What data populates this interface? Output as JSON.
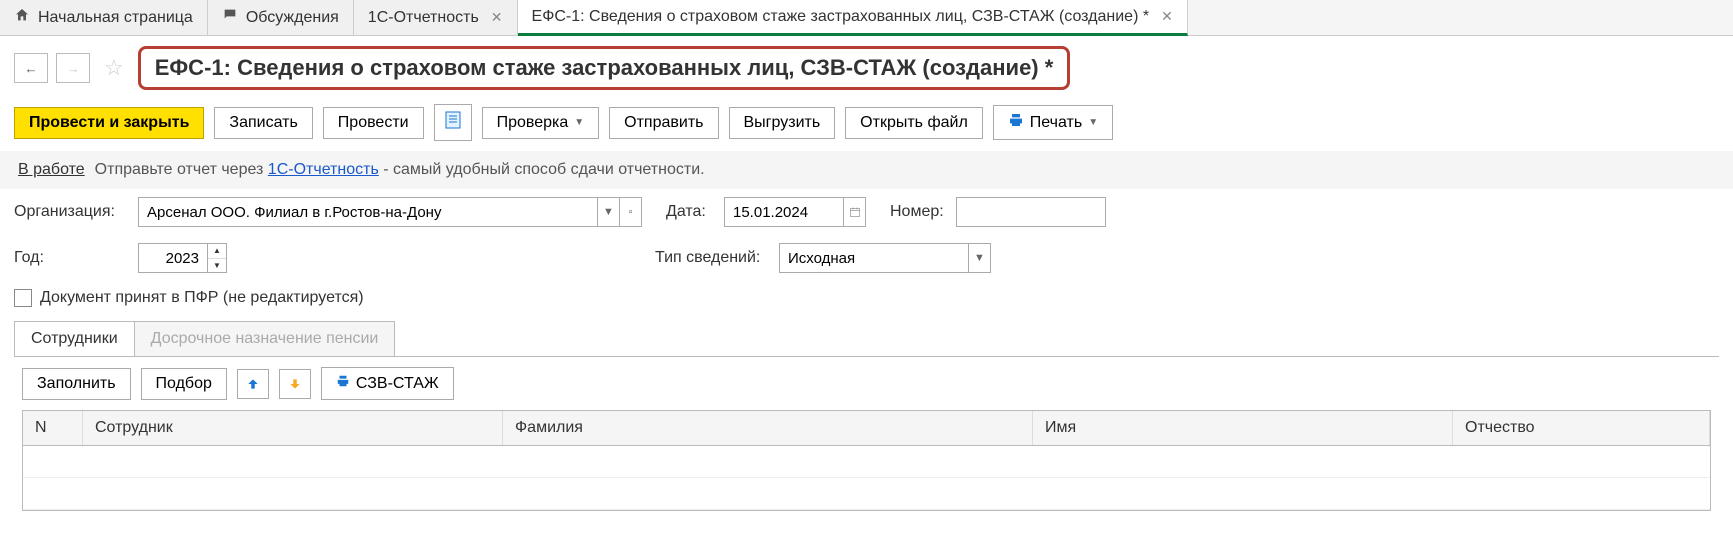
{
  "tabs": [
    {
      "icon": "home",
      "label": "Начальная страница"
    },
    {
      "icon": "discuss",
      "label": "Обсуждения"
    },
    {
      "label": "1С-Отчетность",
      "closable": true
    },
    {
      "label": "ЕФС-1: Сведения о страховом стаже застрахованных лиц, СЗВ-СТАЖ (создание) *",
      "closable": true,
      "active": true
    }
  ],
  "page_title": "ЕФС-1: Сведения о страховом стаже застрахованных лиц, СЗВ-СТАЖ (создание) *",
  "toolbar": {
    "post_close": "Провести и закрыть",
    "save": "Записать",
    "post": "Провести",
    "check": "Проверка",
    "send": "Отправить",
    "export": "Выгрузить",
    "open_file": "Открыть файл",
    "print": "Печать"
  },
  "info": {
    "status": "В работе",
    "prefix": "Отправьте отчет через ",
    "link": "1С-Отчетность",
    "suffix": " - самый удобный способ сдачи отчетности."
  },
  "form": {
    "org_label": "Организация:",
    "org_value": "Арсенал ООО. Филиал в г.Ростов-на-Дону",
    "date_label": "Дата:",
    "date_value": "15.01.2024",
    "number_label": "Номер:",
    "number_value": "",
    "year_label": "Год:",
    "year_value": "2023",
    "type_label": "Тип сведений:",
    "type_value": "Исходная",
    "checkbox_label": "Документ принят в ПФР (не редактируется)"
  },
  "subtabs": {
    "employees": "Сотрудники",
    "early_pension": "Досрочное назначение пенсии"
  },
  "subtoolbar": {
    "fill": "Заполнить",
    "pick": "Подбор",
    "szv_stazh": "СЗВ-СТАЖ"
  },
  "grid": {
    "cols": {
      "n": "N",
      "employee": "Сотрудник",
      "surname": "Фамилия",
      "name": "Имя",
      "patronymic": "Отчество"
    }
  }
}
